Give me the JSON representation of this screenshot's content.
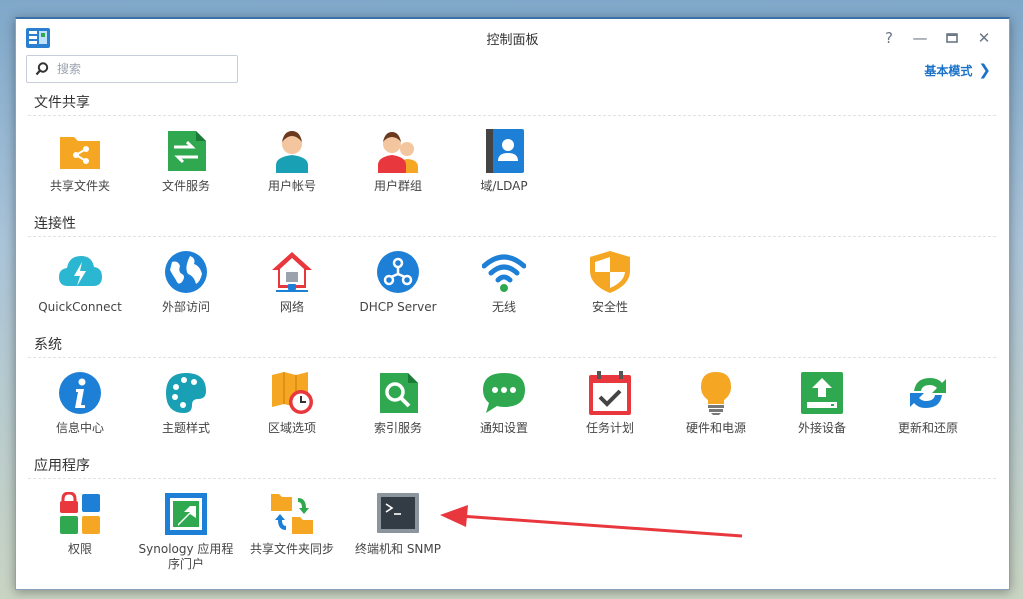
{
  "window": {
    "title": "控制面板"
  },
  "search": {
    "placeholder": "搜索"
  },
  "basic_mode": {
    "label": "基本模式"
  },
  "sections": {
    "file_sharing": {
      "title": "文件共享",
      "items": [
        "共享文件夹",
        "文件服务",
        "用户帐号",
        "用户群组",
        "域/LDAP"
      ]
    },
    "connectivity": {
      "title": "连接性",
      "items": [
        "QuickConnect",
        "外部访问",
        "网络",
        "DHCP Server",
        "无线",
        "安全性"
      ]
    },
    "system": {
      "title": "系统",
      "items": [
        "信息中心",
        "主题样式",
        "区域选项",
        "索引服务",
        "通知设置",
        "任务计划",
        "硬件和电源",
        "外接设备",
        "更新和还原"
      ]
    },
    "applications": {
      "title": "应用程序",
      "items": [
        "权限",
        "Synology 应用程序门户",
        "共享文件夹同步",
        "终端机和 SNMP"
      ]
    }
  },
  "colors": {
    "accent": "#1a72c9",
    "orange": "#f5a623",
    "green": "#2fa84f",
    "blue": "#1e7fd6",
    "red_arrow": "#e8373d"
  }
}
